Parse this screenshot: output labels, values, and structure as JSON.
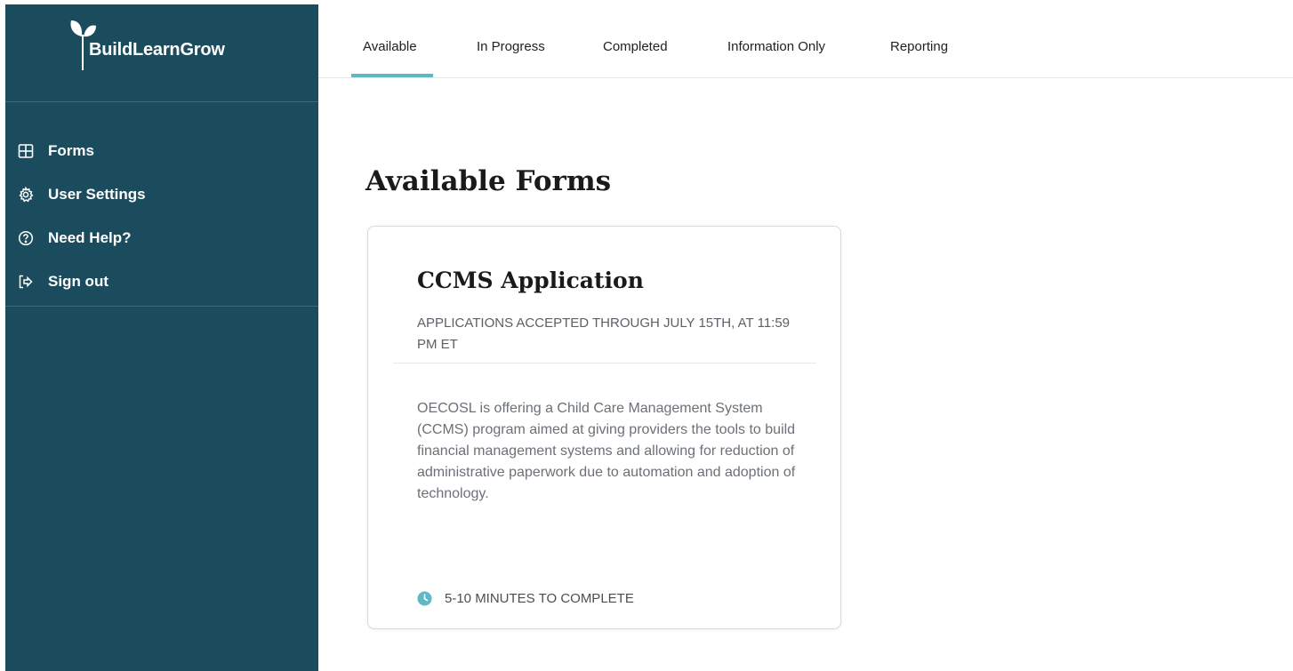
{
  "brand": {
    "name": "BuildLearnGrow",
    "sidebar_color": "#1b4c5e",
    "accent_color": "#5fb8c4"
  },
  "sidebar": {
    "items": [
      {
        "label": "Forms",
        "icon": "grid-icon"
      },
      {
        "label": "User Settings",
        "icon": "gear-icon"
      },
      {
        "label": "Need Help?",
        "icon": "help-circle-icon"
      },
      {
        "label": "Sign out",
        "icon": "sign-out-icon"
      }
    ]
  },
  "tabs": [
    {
      "label": "Available",
      "active": true
    },
    {
      "label": "In Progress",
      "active": false
    },
    {
      "label": "Completed",
      "active": false
    },
    {
      "label": "Information Only",
      "active": false
    },
    {
      "label": "Reporting",
      "active": false
    }
  ],
  "main": {
    "title": "Available Forms",
    "cards": [
      {
        "title": "CCMS Application",
        "deadline": "APPLICATIONS ACCEPTED THROUGH JULY 15TH, AT 11:59 PM ET",
        "description": "OECOSL is offering a Child Care Management System (CCMS) program aimed at giving providers the tools to build financial management systems and allowing for reduction of administrative paperwork due to automation and adoption of technology.",
        "duration": "5-10 MINUTES TO COMPLETE",
        "duration_icon": "clock-icon"
      }
    ]
  }
}
